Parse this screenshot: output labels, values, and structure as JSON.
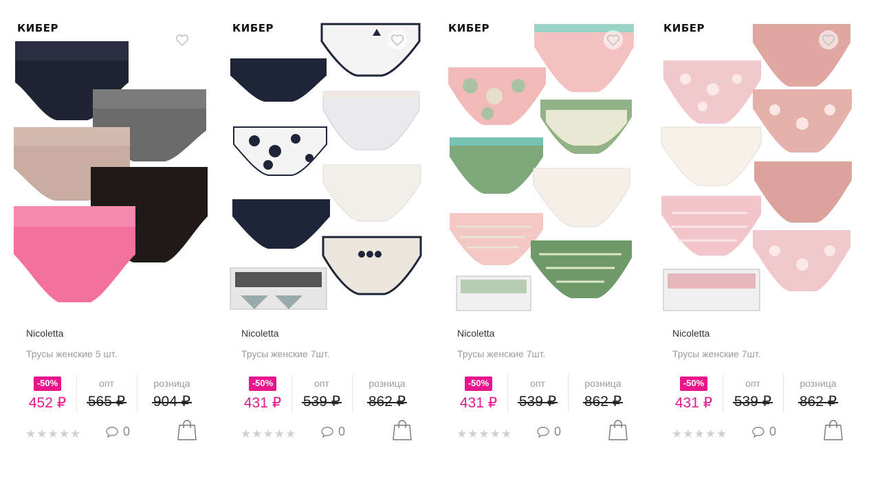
{
  "products": [
    {
      "promo": "КИБЕР",
      "brand": "Nicoletta",
      "title": "Трусы женские 5 шт.",
      "discount": "-50%",
      "sale_price": "452 ₽",
      "wholesale_label": "опт",
      "wholesale_price": "565 ₽",
      "retail_label": "розница",
      "retail_price": "904 ₽",
      "rating_stars": "★★★★★",
      "comments_count": "0",
      "image_colors": [
        "#1f2433",
        "#6b6b6b",
        "#c9ada1",
        "#1f1a18",
        "#f4719e"
      ]
    },
    {
      "promo": "КИБЕР",
      "brand": "Nicoletta",
      "title": "Трусы женские 7шт.",
      "discount": "-50%",
      "sale_price": "431 ₽",
      "wholesale_label": "опт",
      "wholesale_price": "539 ₽",
      "retail_label": "розница",
      "retail_price": "862 ₽",
      "rating_stars": "★★★★★",
      "comments_count": "0",
      "image_colors": [
        "#1e2538",
        "#f4f4f4",
        "#e9e9ee",
        "#1e2538",
        "#f2efe8",
        "#f5f2ea",
        "#ebe7de"
      ]
    },
    {
      "promo": "КИБЕР",
      "brand": "Nicoletta",
      "title": "Трусы женские 7шт.",
      "discount": "-50%",
      "sale_price": "431 ₽",
      "wholesale_label": "опт",
      "wholesale_price": "539 ₽",
      "retail_label": "розница",
      "retail_price": "862 ₽",
      "rating_stars": "★★★★★",
      "comments_count": "0",
      "image_colors": [
        "#f2b9b9",
        "#f4c1c1",
        "#7fa87a",
        "#90b286",
        "#f5efe6",
        "#f3c7c4",
        "#6e9a6a"
      ]
    },
    {
      "promo": "КИБЕР",
      "brand": "Nicoletta",
      "title": "Трусы женские 7шт.",
      "discount": "-50%",
      "sale_price": "431 ₽",
      "wholesale_label": "опт",
      "wholesale_price": "539 ₽",
      "retail_label": "розница",
      "retail_price": "862 ₽",
      "rating_stars": "★★★★★",
      "comments_count": "0",
      "image_colors": [
        "#f1c9cd",
        "#e0a7a0",
        "#f6f1e9",
        "#e7b1ab",
        "#f1c5c9",
        "#dca39c",
        "#f0c8cb"
      ]
    }
  ],
  "icons": {
    "favorite": "heart-outline-icon",
    "comments": "speech-bubble-icon",
    "cart": "shopping-bag-icon"
  },
  "colors": {
    "accent": "#e8168a",
    "muted_text": "#9a9a9a",
    "star_empty": "#d0d0d0"
  }
}
